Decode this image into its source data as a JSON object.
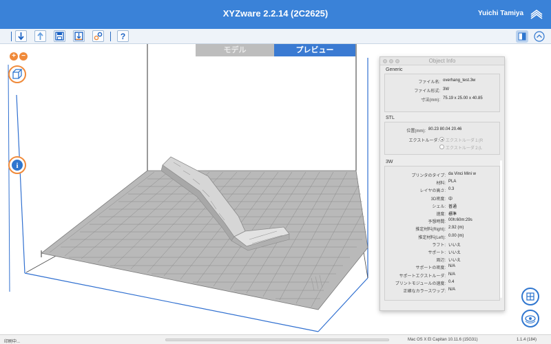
{
  "window": {
    "title": "XYZware 2.2.14 (2C2625)",
    "user": "Yuichi Tamiya"
  },
  "toolbar": {
    "icons": [
      "import-icon",
      "export-icon",
      "save-icon",
      "print-icon",
      "settings-icon",
      "help-icon"
    ],
    "accent": "#3a82d8"
  },
  "tabs": {
    "model": "モデル",
    "preview": "プレビュー",
    "active": "preview"
  },
  "object_info": {
    "title": "Object Info",
    "generic": {
      "label": "Generic",
      "rows": [
        {
          "key": "ファイル名:",
          "value": "overhang_test.3w"
        },
        {
          "key": "ファイル形式:",
          "value": "3W"
        },
        {
          "key": "寸法(mm):",
          "value": "75.19 x 25.00 x 40.85"
        }
      ]
    },
    "stl": {
      "label": "STL",
      "position_key": "位置(mm):",
      "position_value": "80.23  80.04  20.46",
      "extruder_key": "エクストルーダ:",
      "extruder_options": [
        "エクストルーダ１(R",
        "エクストルーダ２(L"
      ],
      "extruder_selected": 0
    },
    "threew": {
      "label": "3W",
      "rows": [
        {
          "key": "プリンタのタイプ:",
          "value": "da Vinci Mini w"
        },
        {
          "key": "材料:",
          "value": "PLA"
        },
        {
          "key": "レイヤの高さ:",
          "value": "0.3"
        },
        {
          "key": "3D密度:",
          "value": "中"
        },
        {
          "key": "シェル:",
          "value": "普通"
        },
        {
          "key": "速度:",
          "value": "標準"
        },
        {
          "key": "予想時間:",
          "value": "00h:60m:29s"
        },
        {
          "key": "推定材料(Right):",
          "value": "2.92 (m)"
        },
        {
          "key": "推定材料(Left):",
          "value": "0.00 (m)"
        },
        {
          "key": "ラフト:",
          "value": "いいえ"
        },
        {
          "key": "サポート:",
          "value": "いいえ"
        },
        {
          "key": "周辺:",
          "value": "いいえ"
        },
        {
          "key": "サポートの密度:",
          "value": "N/A"
        },
        {
          "key": "サポートエクストルーダ:",
          "value": "N/A"
        },
        {
          "key": "プリントモジュールの速度:",
          "value": "0.4"
        },
        {
          "key": "正確なカラースワップ:",
          "value": "N/A"
        }
      ]
    }
  },
  "status": {
    "left": "印刷中...",
    "os": "Mac OS X El Capitan 10.11.6 (15G31)",
    "version": "1.1.4 (184)"
  }
}
